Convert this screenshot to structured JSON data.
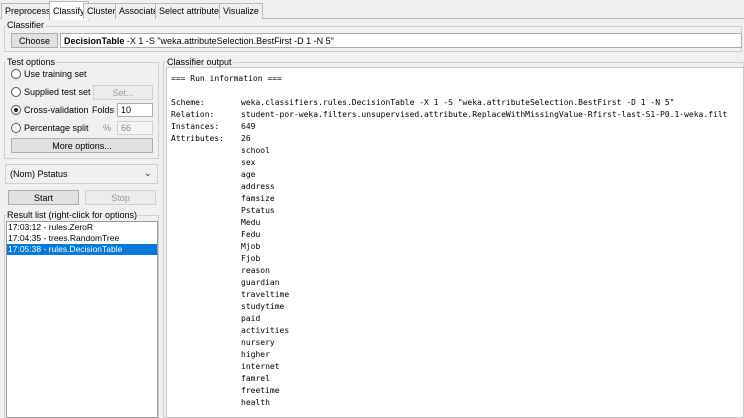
{
  "tabs": [
    "Preprocess",
    "Classify",
    "Cluster",
    "Associate",
    "Select attributes",
    "Visualize"
  ],
  "active_tab": "Classify",
  "classifier": {
    "group_label": "Classifier",
    "choose_label": "Choose",
    "name": "DecisionTable",
    "options": " -X 1 -S \"weka.attributeSelection.BestFirst -D 1 -N 5\""
  },
  "test_options": {
    "group_label": "Test options",
    "use_training": "Use training set",
    "supplied": "Supplied test set",
    "set_label": "Set...",
    "cross_validation": "Cross-validation",
    "folds_label": "Folds",
    "folds_value": "10",
    "percentage": "Percentage split",
    "percent_label": "%",
    "percent_value": "66",
    "selected": "cross_validation",
    "more_options": "More options..."
  },
  "class_attribute": "(Nom) Pstatus",
  "start_label": "Start",
  "stop_label": "Stop",
  "result_list": {
    "label": "Result list (right-click for options)",
    "items": [
      "17:03:12 - rules.ZeroR",
      "17:04:35 - trees.RandomTree",
      "17:05:38 - rules.DecisionTable"
    ],
    "selected_index": 2
  },
  "output": {
    "label": "Classifier output",
    "run_info": "=== Run information ===",
    "fields": [
      {
        "key": "Scheme:",
        "value": "weka.classifiers.rules.DecisionTable -X 1 -S \"weka.attributeSelection.BestFirst -D 1 -N 5\""
      },
      {
        "key": "Relation:",
        "value": "student-por-weka.filters.unsupervised.attribute.ReplaceWithMissingValue-Rfirst-last-S1-P0.1-weka.filt"
      },
      {
        "key": "Instances:",
        "value": "649"
      },
      {
        "key": "Attributes:",
        "value": "26"
      }
    ],
    "attributes": [
      "school",
      "sex",
      "age",
      "address",
      "famsize",
      "Pstatus",
      "Medu",
      "Fedu",
      "Mjob",
      "Fjob",
      "reason",
      "guardian",
      "traveltime",
      "studytime",
      "paid",
      "activities",
      "nursery",
      "higher",
      "internet",
      "famrel",
      "freetime",
      "health"
    ]
  }
}
